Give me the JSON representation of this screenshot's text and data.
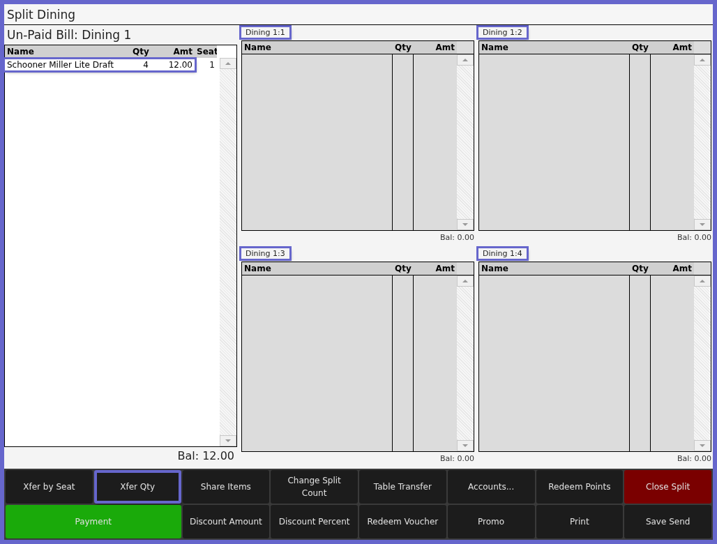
{
  "window": {
    "title": "Split Dining"
  },
  "bill": {
    "title": "Un-Paid Bill: Dining 1",
    "columns": [
      "Name",
      "Qty",
      "Amt",
      "Seat"
    ],
    "rows": [
      {
        "name": "Schooner Miller Lite Draft",
        "qty": "4",
        "amt": "12.00",
        "seat": "1",
        "highlighted": true
      }
    ],
    "balance": "Bal: 12.00"
  },
  "splits": [
    {
      "label": "Dining 1:1",
      "highlighted": true,
      "columns": [
        "Name",
        "Qty",
        "Amt"
      ],
      "balance": "Bal: 0.00"
    },
    {
      "label": "Dining 1:2",
      "highlighted": true,
      "columns": [
        "Name",
        "Qty",
        "Amt"
      ],
      "balance": "Bal: 0.00"
    },
    {
      "label": "Dining 1:3",
      "highlighted": true,
      "columns": [
        "Name",
        "Qty",
        "Amt"
      ],
      "balance": "Bal: 0.00"
    },
    {
      "label": "Dining 1:4",
      "highlighted": true,
      "columns": [
        "Name",
        "Qty",
        "Amt"
      ],
      "balance": "Bal: 0.00"
    }
  ],
  "buttons": [
    {
      "label": "Xfer by Seat",
      "kind": "normal",
      "highlighted": false
    },
    {
      "label": "Xfer Qty",
      "kind": "normal",
      "highlighted": true
    },
    {
      "label": "Share Items",
      "kind": "normal",
      "highlighted": false
    },
    {
      "label": "Change Split Count",
      "kind": "normal",
      "highlighted": false
    },
    {
      "label": "Table Transfer",
      "kind": "normal",
      "highlighted": false
    },
    {
      "label": "Accounts...",
      "kind": "normal",
      "highlighted": false
    },
    {
      "label": "Redeem Points",
      "kind": "normal",
      "highlighted": false
    },
    {
      "label": "Close Split",
      "kind": "danger",
      "highlighted": false
    },
    {
      "label": "Payment",
      "kind": "primary",
      "highlighted": false
    },
    {
      "label": "Discount Amount",
      "kind": "normal",
      "highlighted": false
    },
    {
      "label": "Discount Percent",
      "kind": "normal",
      "highlighted": false
    },
    {
      "label": "Redeem Voucher",
      "kind": "normal",
      "highlighted": false
    },
    {
      "label": "Promo",
      "kind": "normal",
      "highlighted": false
    },
    {
      "label": "Print",
      "kind": "normal",
      "highlighted": false
    },
    {
      "label": "Save Send",
      "kind": "normal",
      "highlighted": false
    }
  ]
}
